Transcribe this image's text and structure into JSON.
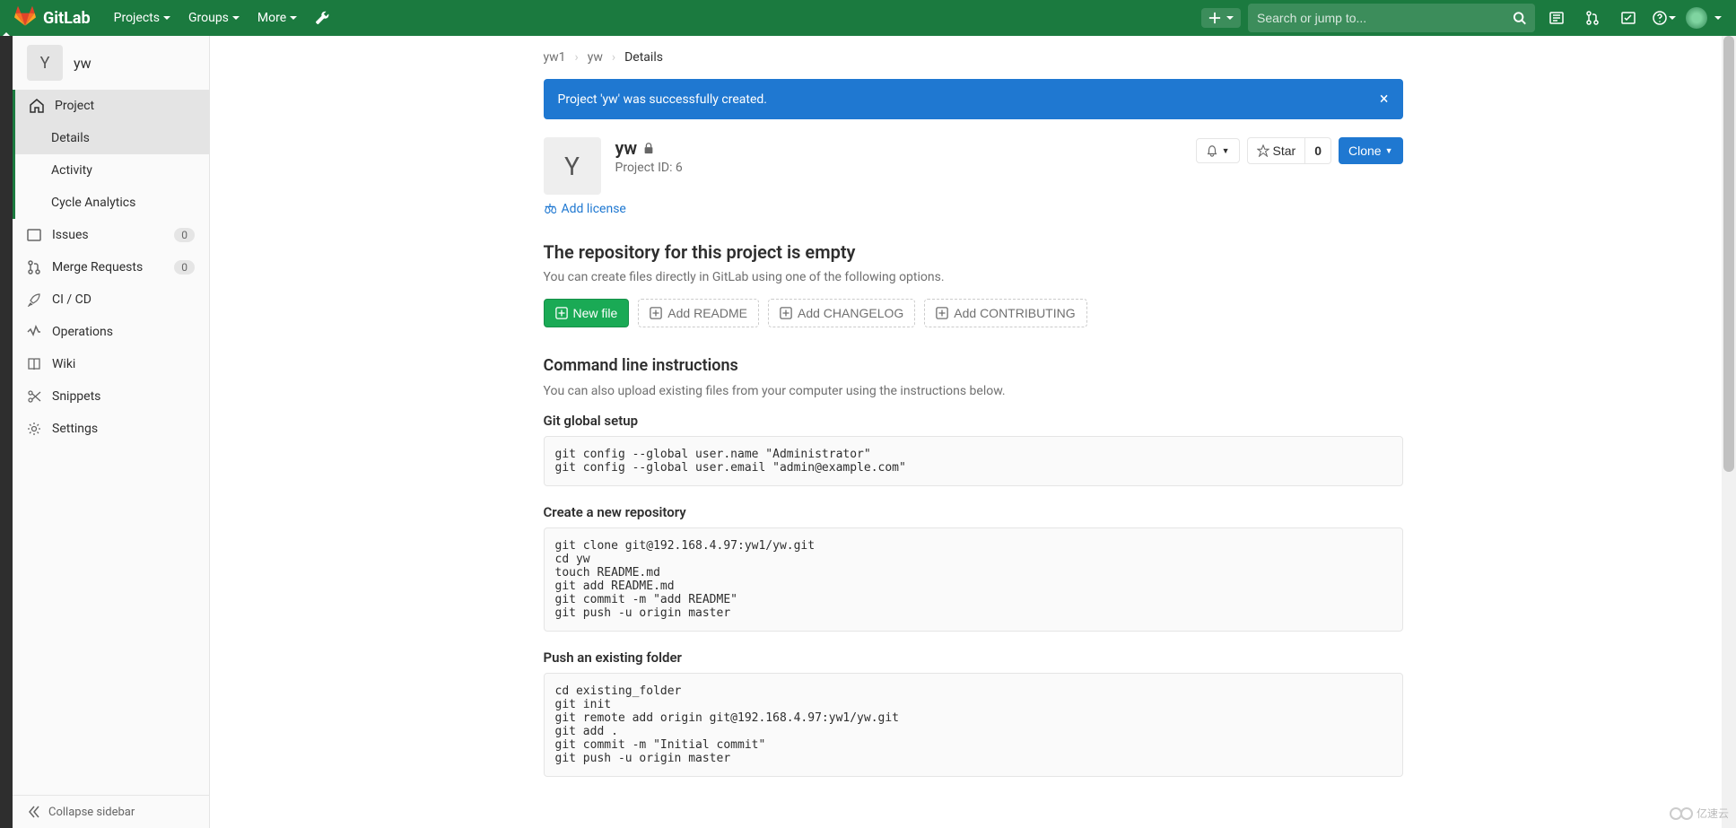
{
  "navbar": {
    "brand": "GitLab",
    "projects": "Projects",
    "groups": "Groups",
    "more": "More",
    "search_placeholder": "Search or jump to..."
  },
  "sidebar": {
    "project_initial": "Y",
    "project_name": "yw",
    "items": {
      "project": "Project",
      "details": "Details",
      "activity": "Activity",
      "cycle": "Cycle Analytics",
      "issues": "Issues",
      "issues_count": "0",
      "mr": "Merge Requests",
      "mr_count": "0",
      "cicd": "CI / CD",
      "operations": "Operations",
      "wiki": "Wiki",
      "snippets": "Snippets",
      "settings": "Settings"
    },
    "collapse": "Collapse sidebar"
  },
  "breadcrumbs": {
    "a": "yw1",
    "b": "yw",
    "c": "Details"
  },
  "alert": "Project 'yw' was successfully created.",
  "project": {
    "avatar": "Y",
    "name": "yw",
    "id_label": "Project ID: 6",
    "star_label": "Star",
    "star_count": "0",
    "clone": "Clone",
    "add_license": "Add license"
  },
  "empty": {
    "title": "The repository for this project is empty",
    "subtitle": "You can create files directly in GitLab using one of the following options.",
    "new_file": "New file",
    "readme": "Add README",
    "changelog": "Add CHANGELOG",
    "contributing": "Add CONTRIBUTING"
  },
  "cli": {
    "title": "Command line instructions",
    "subtitle": "You can also upload existing files from your computer using the instructions below.",
    "setup_title": "Git global setup",
    "setup_code": "git config --global user.name \"Administrator\"\ngit config --global user.email \"admin@example.com\"",
    "create_title": "Create a new repository",
    "create_code": "git clone git@192.168.4.97:yw1/yw.git\ncd yw\ntouch README.md\ngit add README.md\ngit commit -m \"add README\"\ngit push -u origin master",
    "push_title": "Push an existing folder",
    "push_code": "cd existing_folder\ngit init\ngit remote add origin git@192.168.4.97:yw1/yw.git\ngit add .\ngit commit -m \"Initial commit\"\ngit push -u origin master"
  },
  "watermark": "亿速云"
}
